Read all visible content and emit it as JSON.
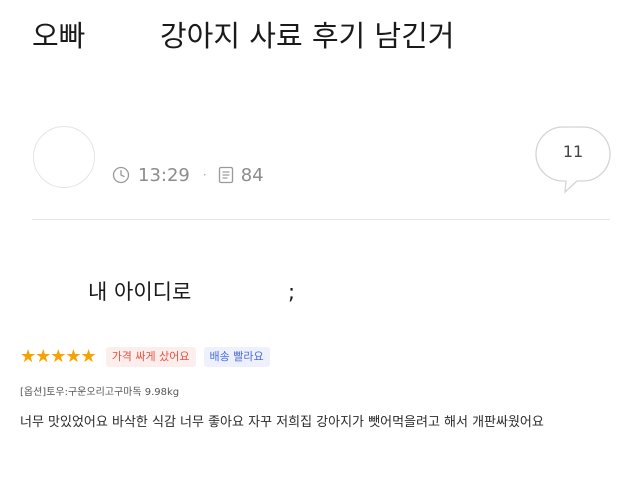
{
  "header": {
    "author_label": "오빠",
    "title": "강아지 사료 후기 남긴거"
  },
  "meta": {
    "time": "13:29",
    "separator": "·",
    "views": "84",
    "icons": [
      "clock-icon",
      "document-icon"
    ]
  },
  "comments": {
    "count": "11",
    "icon": "speech-bubble-icon"
  },
  "post": {
    "body_prefix": "내 아이디로",
    "body_suffix": ";"
  },
  "review": {
    "stars": "★★★★★",
    "rating": 5,
    "rating_max": 5,
    "tags": [
      "가격 싸게 샀어요",
      "배송 빨라요"
    ],
    "option": "[옵션]토우:구운오리고구마독 9.98kg",
    "text": "너무 맛있었어요 바삭한 식감 너무 좋아요 자꾸 저희집 강아지가 뺏어먹을려고 해서 개판싸웠어요"
  },
  "colors": {
    "star": "#f5a300",
    "tag_price_text": "#e8513f",
    "tag_price_bg": "#fdeeee",
    "tag_ship_text": "#4a6cdc",
    "tag_ship_bg": "#eef1fc",
    "meta_text": "#8c8c8c"
  }
}
